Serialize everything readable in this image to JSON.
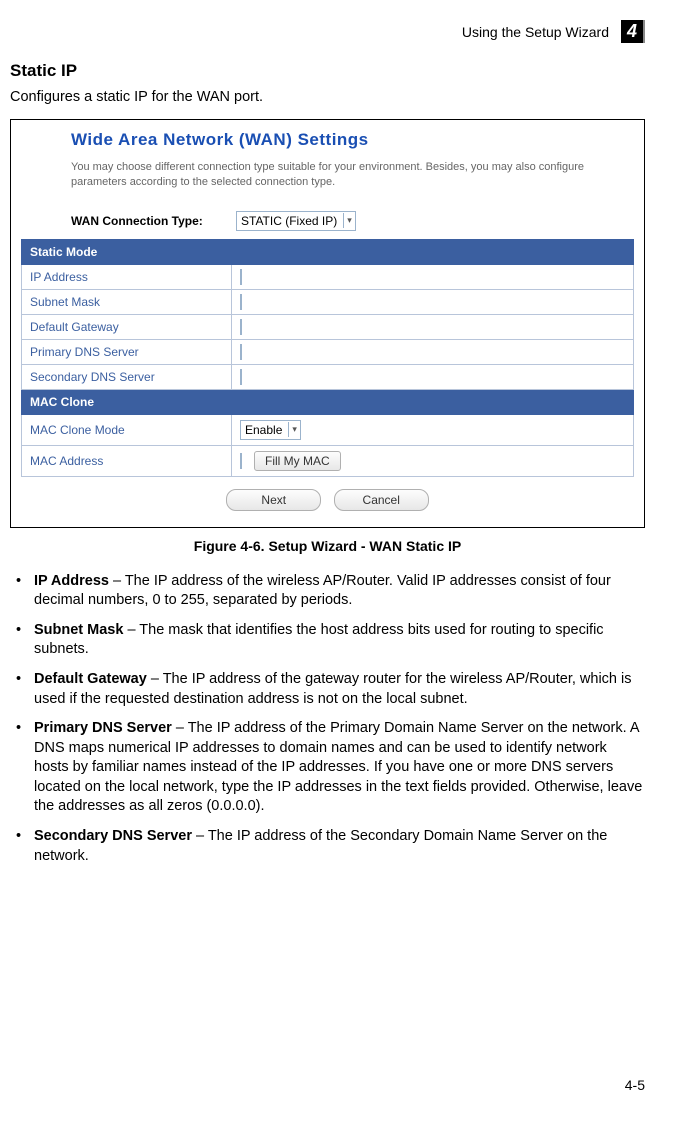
{
  "header": {
    "title": "Using the Setup Wizard",
    "chapter": "4"
  },
  "section": {
    "title": "Static IP",
    "intro": "Configures a static IP for the WAN port."
  },
  "screenshot": {
    "panel_title": "Wide Area Network (WAN) Settings",
    "panel_desc": "You may choose different connection type suitable for your environment. Besides, you may also configure parameters according to the selected connection type.",
    "conn_label": "WAN Connection Type:",
    "conn_value": "STATIC (Fixed IP)",
    "sections": {
      "static_mode": "Static Mode",
      "mac_clone": "MAC Clone"
    },
    "rows": {
      "ip_address": "IP Address",
      "subnet_mask": "Subnet Mask",
      "default_gateway": "Default Gateway",
      "primary_dns": "Primary DNS Server",
      "secondary_dns": "Secondary DNS Server",
      "mac_clone_mode": "MAC Clone Mode",
      "mac_clone_value": "Enable",
      "mac_address": "MAC Address",
      "fill_my_mac": "Fill My MAC"
    },
    "buttons": {
      "next": "Next",
      "cancel": "Cancel"
    }
  },
  "figure_caption": "Figure 4-6.   Setup Wizard - WAN Static IP",
  "bullets": [
    {
      "term": "IP Address",
      "text": " – The IP address of the wireless AP/Router. Valid IP addresses consist of four decimal numbers, 0 to 255, separated by periods."
    },
    {
      "term": "Subnet Mask",
      "text": " – The mask that identifies the host address bits used for routing to specific subnets."
    },
    {
      "term": "Default Gateway",
      "text": " – The IP address of the gateway router for the wireless AP/Router, which is used if the requested destination address is not on the local subnet."
    },
    {
      "term": "Primary DNS Server",
      "text": " – The IP address of the Primary Domain Name Server on the network. A DNS maps numerical IP addresses to domain names and can be used to identify network hosts by familiar names instead of the IP addresses. If you have one or more DNS servers located on the local network, type the IP addresses in the text fields provided. Otherwise, leave the addresses as all zeros (0.0.0.0)."
    },
    {
      "term": "Secondary DNS Server",
      "text": " – The IP address of the Secondary Domain Name Server on the network."
    }
  ],
  "page_number": "4-5"
}
